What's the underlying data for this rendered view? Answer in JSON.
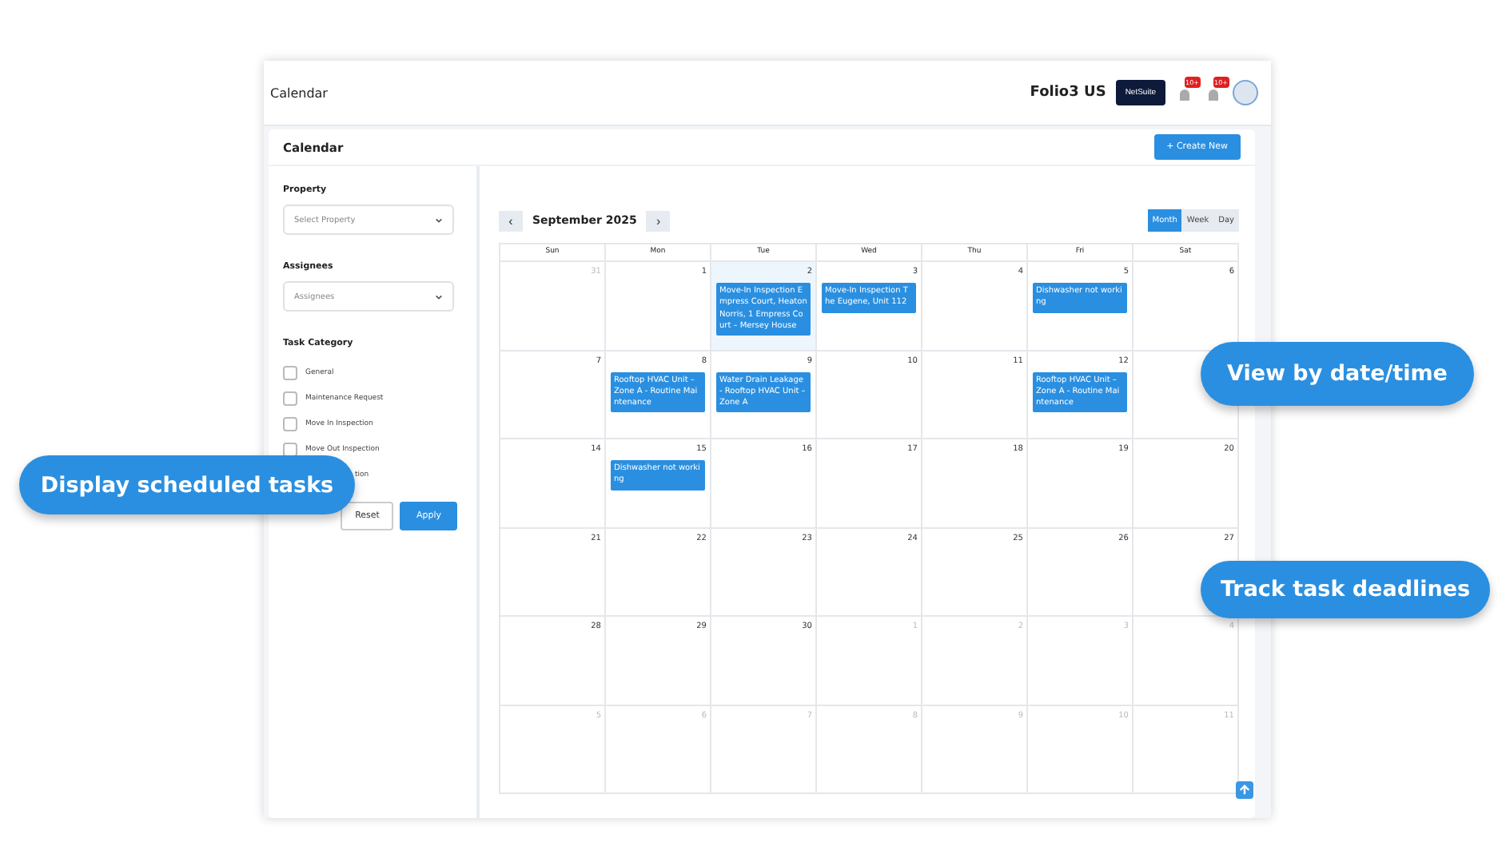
{
  "header": {
    "title": "Calendar",
    "company": "Folio3 US",
    "brand_button": "NetSuite",
    "badges": [
      "10+",
      "10+"
    ]
  },
  "page": {
    "title": "Calendar",
    "create_button": "+ Create New"
  },
  "filters": {
    "property": {
      "label": "Property",
      "placeholder": "Select Property"
    },
    "assignees": {
      "label": "Assignees",
      "placeholder": "Assignees"
    },
    "category_label": "Task Category",
    "categories": [
      {
        "kind": "checkbox",
        "label": "General",
        "checked": false
      },
      {
        "kind": "checkbox",
        "label": "Maintenance Request",
        "checked": false
      },
      {
        "kind": "checkbox",
        "label": "Move In Inspection",
        "checked": false
      },
      {
        "kind": "checkbox",
        "label": "Move Out Inspection",
        "checked": false
      },
      {
        "kind": "covered",
        "label": "tion"
      }
    ],
    "reset": "Reset",
    "apply": "Apply"
  },
  "calendar": {
    "month": "September 2025",
    "prev": "‹",
    "next": "›",
    "views": [
      {
        "label": "Month",
        "selected": true
      },
      {
        "label": "Week",
        "selected": false
      },
      {
        "label": "Day",
        "selected": false
      }
    ],
    "weekdays": [
      "Sun",
      "Mon",
      "Tue",
      "Wed",
      "Thu",
      "Fri",
      "Sat"
    ],
    "weeks": [
      {
        "days": [
          {
            "date": "31",
            "outside": true,
            "today": false
          },
          {
            "date": "1",
            "outside": false,
            "today": false
          },
          {
            "date": "2",
            "outside": false,
            "today": true,
            "events": [
              "Move-In Inspection Empress Court, Heaton Norris, 1 Empress Court – Mersey House"
            ]
          },
          {
            "date": "3",
            "outside": false,
            "today": false,
            "events": [
              "Move-In Inspection The Eugene, Unit 112"
            ]
          },
          {
            "date": "4",
            "outside": false,
            "today": false
          },
          {
            "date": "5",
            "outside": false,
            "today": false,
            "events": [
              "Dishwasher not working"
            ]
          },
          {
            "date": "6",
            "outside": false,
            "today": false
          }
        ]
      },
      {
        "days": [
          {
            "date": "7",
            "outside": false,
            "today": false
          },
          {
            "date": "8",
            "outside": false,
            "today": false,
            "events": [
              "Rooftop HVAC Unit – Zone A - Routine Maintenance"
            ]
          },
          {
            "date": "9",
            "outside": false,
            "today": false,
            "events": [
              "Water Drain Leakage - Rooftop HVAC Unit – Zone A"
            ]
          },
          {
            "date": "10",
            "outside": false,
            "today": false
          },
          {
            "date": "11",
            "outside": false,
            "today": false
          },
          {
            "date": "12",
            "outside": false,
            "today": false,
            "events": [
              "Rooftop HVAC Unit – Zone A - Routine Maintenance"
            ]
          },
          {
            "today": false
          }
        ]
      },
      {
        "days": [
          {
            "date": "14",
            "outside": false,
            "today": false
          },
          {
            "date": "15",
            "outside": false,
            "today": false,
            "events": [
              "Dishwasher not working"
            ]
          },
          {
            "date": "16",
            "outside": false,
            "today": false
          },
          {
            "date": "17",
            "outside": false,
            "today": false
          },
          {
            "date": "18",
            "outside": false,
            "today": false
          },
          {
            "date": "19",
            "outside": false,
            "today": false
          },
          {
            "date": "20",
            "outside": false,
            "today": false
          }
        ]
      },
      {
        "days": [
          {
            "date": "21",
            "outside": false,
            "today": false
          },
          {
            "date": "22",
            "outside": false,
            "today": false
          },
          {
            "date": "23",
            "outside": false,
            "today": false
          },
          {
            "date": "24",
            "outside": false,
            "today": false
          },
          {
            "date": "25",
            "outside": false,
            "today": false
          },
          {
            "date": "26",
            "outside": false,
            "today": false
          },
          {
            "date": "27",
            "outside": false,
            "today": false
          }
        ]
      },
      {
        "days": [
          {
            "date": "28",
            "outside": false,
            "today": false
          },
          {
            "date": "29",
            "outside": false,
            "today": false
          },
          {
            "date": "30",
            "outside": false,
            "today": false
          },
          {
            "date": "1",
            "outside": true,
            "today": false
          },
          {
            "date": "2",
            "outside": true,
            "today": false
          },
          {
            "date": "3",
            "outside": true,
            "today": false
          },
          {
            "date": "4",
            "outside": true,
            "today": false
          }
        ]
      },
      {
        "days": [
          {
            "date": "5",
            "outside": true,
            "today": false
          },
          {
            "date": "6",
            "outside": true,
            "today": false
          },
          {
            "date": "7",
            "outside": true,
            "today": false
          },
          {
            "date": "8",
            "outside": true,
            "today": false
          },
          {
            "date": "9",
            "outside": true,
            "today": false
          },
          {
            "date": "10",
            "outside": true,
            "today": false
          },
          {
            "date": "11",
            "outside": true,
            "today": false
          }
        ]
      }
    ]
  },
  "callouts": [
    "Display scheduled tasks",
    "View by date/time",
    "Track task deadlines"
  ]
}
